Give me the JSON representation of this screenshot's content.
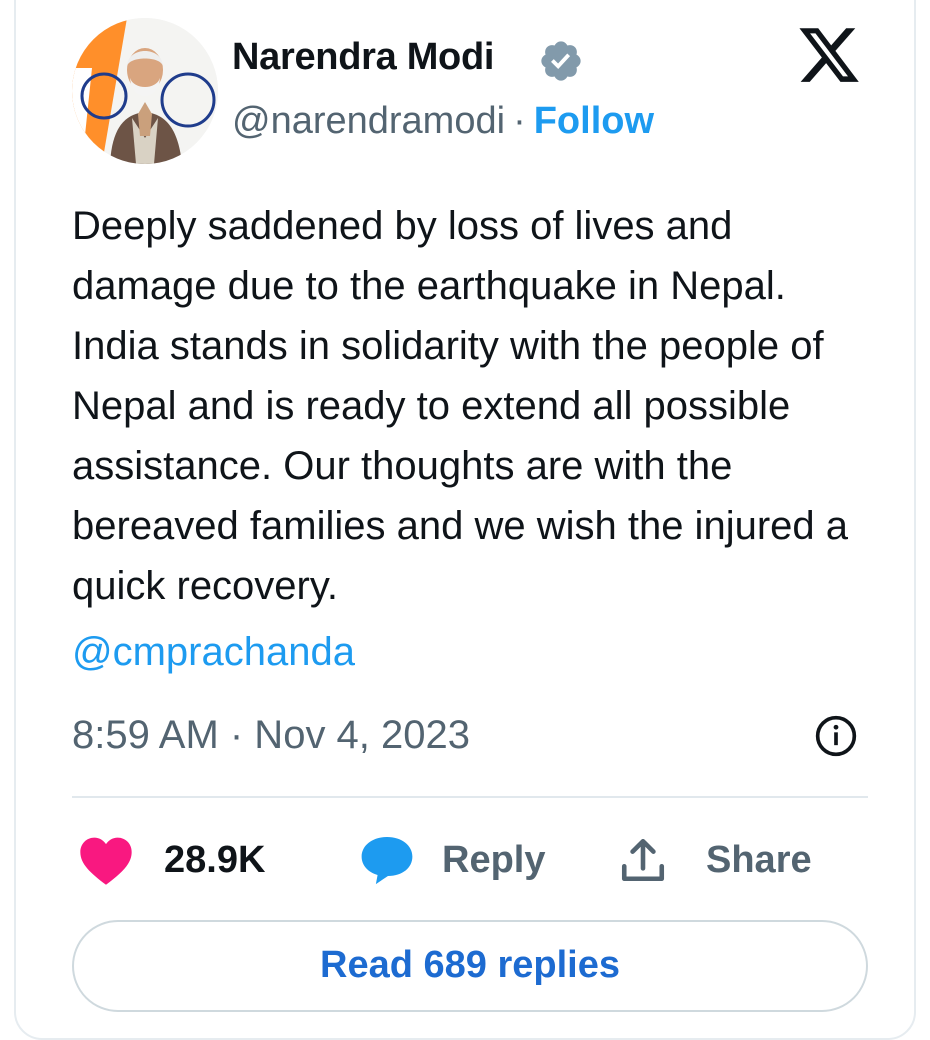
{
  "author": {
    "name": "Narendra Modi",
    "handle": "@narendramodi",
    "separator": "·",
    "follow_label": "Follow"
  },
  "icons": {
    "verified": "verified-badge-icon",
    "platform": "x-logo-icon",
    "info": "info-icon",
    "like": "heart-icon",
    "reply": "speech-bubble-icon",
    "share": "share-icon"
  },
  "tweet": {
    "text": "Deeply saddened by loss of lives and damage due to the earthquake in Nepal. India stands in solidarity with the people of Nepal and is ready to extend all possible assistance. Our thoughts are with the bereaved families and we wish the injured a quick recovery.",
    "mention": "@cmprachanda",
    "timestamp": "8:59 AM · Nov 4, 2023"
  },
  "actions": {
    "like_count": "28.9K",
    "reply_label": "Reply",
    "share_label": "Share"
  },
  "read_replies_label": "Read 689 replies",
  "colors": {
    "link": "#1d9bf0",
    "like": "#f91880",
    "reply_icon": "#1d9bf0",
    "text": "#0f1419",
    "muted": "#536471"
  }
}
